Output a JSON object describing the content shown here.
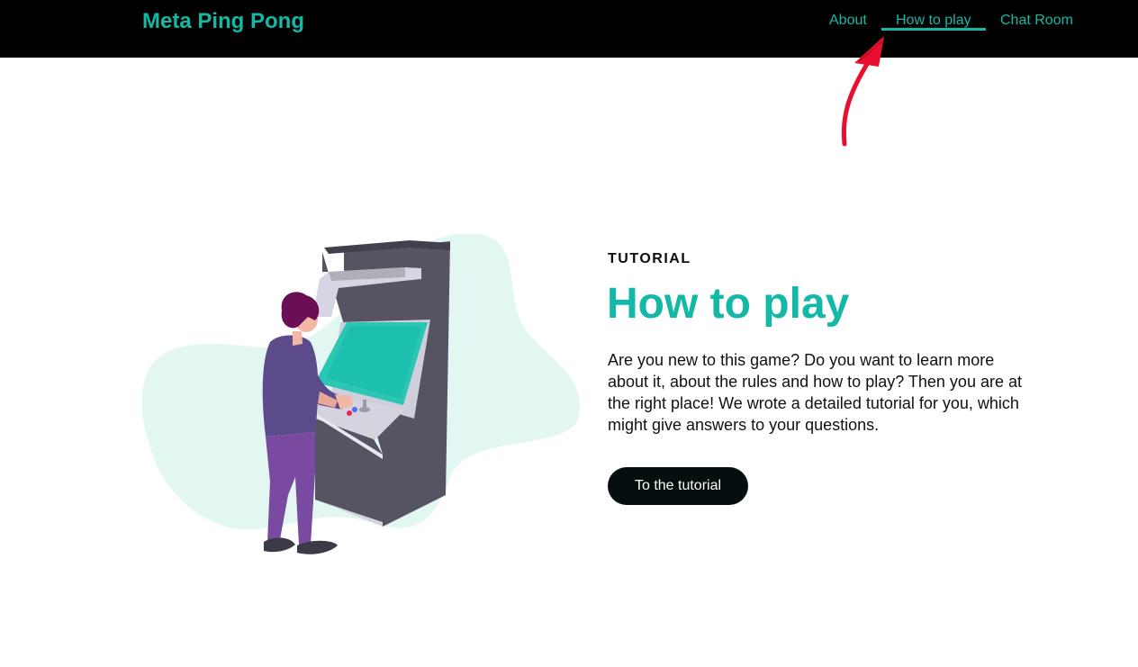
{
  "header": {
    "brand": "Meta Ping Pong",
    "nav": [
      {
        "label": "About"
      },
      {
        "label": "How to play",
        "active": true
      },
      {
        "label": "Chat Room"
      }
    ]
  },
  "hero": {
    "eyebrow": "TUTORIAL",
    "title": "How to play",
    "description": "Are you new to this game? Do you want to learn more about it, about the rules and how to play? Then you are at the right place! We wrote a detailed tutorial for you, which might give answers to your questions.",
    "cta_label": "To the tutorial"
  },
  "colors": {
    "accent": "#14b8a6",
    "nav_background": "#000000",
    "button_background": "#050f0f",
    "annotation": "#e8102e"
  },
  "icons": {
    "annotation": "red-arrow-icon",
    "illustration": "arcade-player-illustration"
  }
}
